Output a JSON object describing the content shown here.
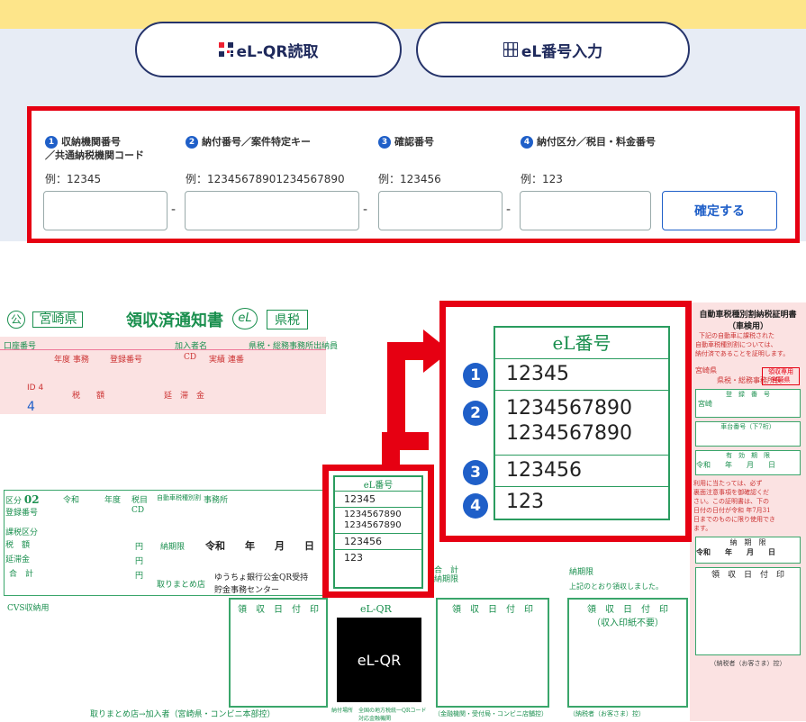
{
  "tabs": [
    {
      "label": "eL-QR読取"
    },
    {
      "label": "eL番号入力"
    }
  ],
  "form": {
    "fields": [
      {
        "num": "1",
        "label": "収納機関番号",
        "label2": "／共通納税機関コード",
        "example": "例：12345"
      },
      {
        "num": "2",
        "label": "納付番号／案件特定キー",
        "label2": "",
        "example": "例：12345678901234567890"
      },
      {
        "num": "3",
        "label": "確認番号",
        "label2": "",
        "example": "例：123456"
      },
      {
        "num": "4",
        "label": "納付区分／税目・料金番号",
        "label2": "",
        "example": "例：123"
      }
    ],
    "submit_label": "確定する"
  },
  "document": {
    "pref_logo": "公",
    "pref": "宮崎県",
    "title": "領収済通知書",
    "el_mark": "eL",
    "tax": "県税",
    "account_no": "口座番号",
    "subscriber": "加入者名",
    "office": "県税・総務事務所出納員",
    "year_row": "年度 事務",
    "reg_no": "登録番号",
    "cd": "CD",
    "pay_rate": "実績 連番",
    "tax_label": "税　　額",
    "late_fee": "延　滞　金",
    "id_label": "ID 4",
    "id_value": "4",
    "kubun": "区分",
    "kubun_val": "02",
    "reiwa": "令和",
    "year": "年度",
    "zeimoku": "税目",
    "vehicle": "自動車税種別割",
    "jimusho": "事務所",
    "register_no_label": "登録番号",
    "tax_class": "課税区分",
    "tax_amt": "税　額",
    "late_amt": "延滞金",
    "total": "合　計",
    "yen": "円",
    "deadline": "納期限",
    "date_row": "令和　　年　　月　　日",
    "collector": "取りまとめ店",
    "bank": "ゆうちょ銀行公金QR受持",
    "bank2": "貯金事務センター",
    "cvs": "CVS収納用",
    "receipt_date": "領　収　日　付　印",
    "footer_left": "取りまとめ店→加入者（宮崎県・コンビニ本部控）",
    "footer_mid1": "納付場所",
    "footer_mid2": "全国の地方税統一QRコード対応金融機関",
    "footer_r1": "（金融機関・受付局・コンビニ店舗控）",
    "footer_r2": "（納税者（お客さま）控）",
    "footer_r3": "（納税者（お客さま）控）",
    "el_qr_label": "eL-QR",
    "el_qr_box": "eL-QR"
  },
  "el_panel_small": {
    "title": "eL番号",
    "values": [
      "12345",
      "1234567890\n1234567890",
      "123456",
      "123"
    ]
  },
  "el_panel_big": {
    "title": "eL番号",
    "values": [
      "12345",
      "1234567890",
      "1234567890",
      "123456",
      "123"
    ],
    "nums": [
      "1",
      "2",
      "3",
      "4"
    ]
  },
  "right_doc": {
    "title": "自動車税種別割納税証明書",
    "subtitle": "（車検用）",
    "text1": "下記の自動車に課税された",
    "text2": "自動車税種別割については、",
    "text3": "納付済であることを証明します。",
    "pref": "宮崎県",
    "stamp": "領収専用",
    "stamp2": "宮崎県",
    "office": "県税・総務事務所長",
    "reg_label": "登　録　番　号",
    "reg_val": "宮崎",
    "car_no": "車台番号（下7桁）",
    "valid": "有　効　期　限",
    "date": "令和　　年　　月　　日",
    "note1": "利用に当たっては、必ず",
    "note2": "裏面注意事項を御確認くだ",
    "note3": "さい。この証明書は、下の",
    "note4": "日付の日付が令和 年7月31",
    "note5": "日までのものに限り使用でき",
    "note6": "ます。",
    "deadline": "納　期　限",
    "date2": "令和　　年　　月　　日",
    "receipt": "領　収　日　付　印",
    "receipt2": "（収入印紙不要）",
    "above_note": "上記のとおり領収しました。",
    "pay_deadline": "納期限"
  }
}
